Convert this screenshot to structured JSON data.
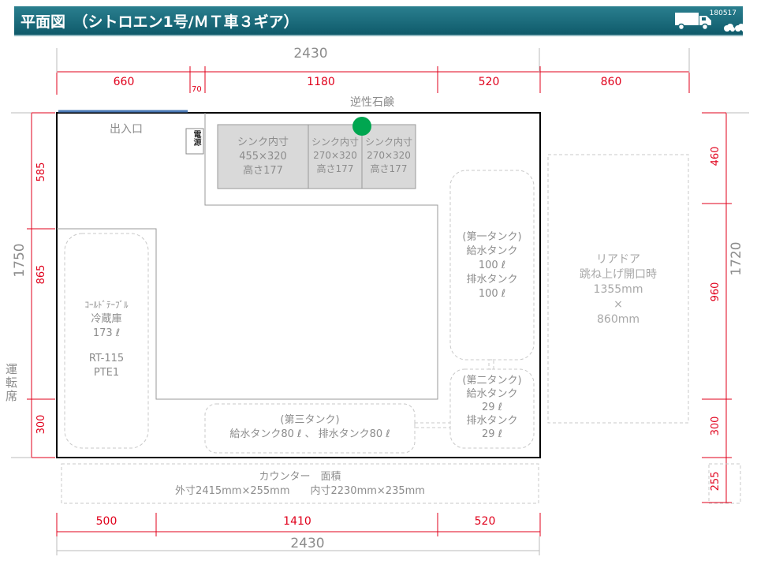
{
  "header": {
    "title": "平面図　（シトロエン1号/ＭＴ車３ギア）",
    "code": "180517"
  },
  "dims_top": {
    "total": "2430",
    "seg1": "660",
    "seg2": "70",
    "seg3": "1180",
    "seg4": "520",
    "seg5": "860"
  },
  "dims_bottom": {
    "total": "2430",
    "seg1": "500",
    "seg2": "1410",
    "seg3": "520"
  },
  "dims_left": {
    "total": "1750",
    "seg1": "585",
    "seg2": "865",
    "seg3": "300"
  },
  "dims_right": {
    "total": "1720",
    "seg1": "460",
    "seg2": "960",
    "seg3": "300",
    "seg4": "255"
  },
  "labels": {
    "soap": "逆性石鹸",
    "entrance": "出入口",
    "power": "電源",
    "driver_seat": "運転席",
    "sink1": [
      "シンク内寸",
      "455×320",
      "高さ177"
    ],
    "sink2": [
      "シンク内寸",
      "270×320",
      "高さ177"
    ],
    "sink3": [
      "シンク内寸",
      "270×320",
      "高さ177"
    ],
    "fridge": [
      "ｺｰﾙﾄﾞﾃｰﾌﾞﾙ",
      "冷蔵庫",
      "173 ℓ",
      "",
      "RT-115",
      "PTE1"
    ],
    "tank1": [
      "(第一タンク)",
      "給水タンク",
      "100 ℓ",
      "排水タンク",
      "100 ℓ"
    ],
    "tank2": [
      "(第二タンク)",
      "給水タンク",
      "29 ℓ",
      "排水タンク",
      "29 ℓ"
    ],
    "tank3": [
      "(第三タンク)",
      "給水タンク80 ℓ 、 排水タンク80 ℓ"
    ],
    "rear_door": [
      "リアドア",
      "跳ね上げ開口時",
      "1355mm",
      "×",
      "860mm"
    ],
    "counter": [
      "カウンター　面積",
      "外寸2415mm×255mm　　内寸2230mm×235mm"
    ]
  },
  "colors": {
    "header": "#146474",
    "dimension": "#e0001b",
    "label": "#8c8c8c",
    "soap_dot": "#00a650"
  }
}
